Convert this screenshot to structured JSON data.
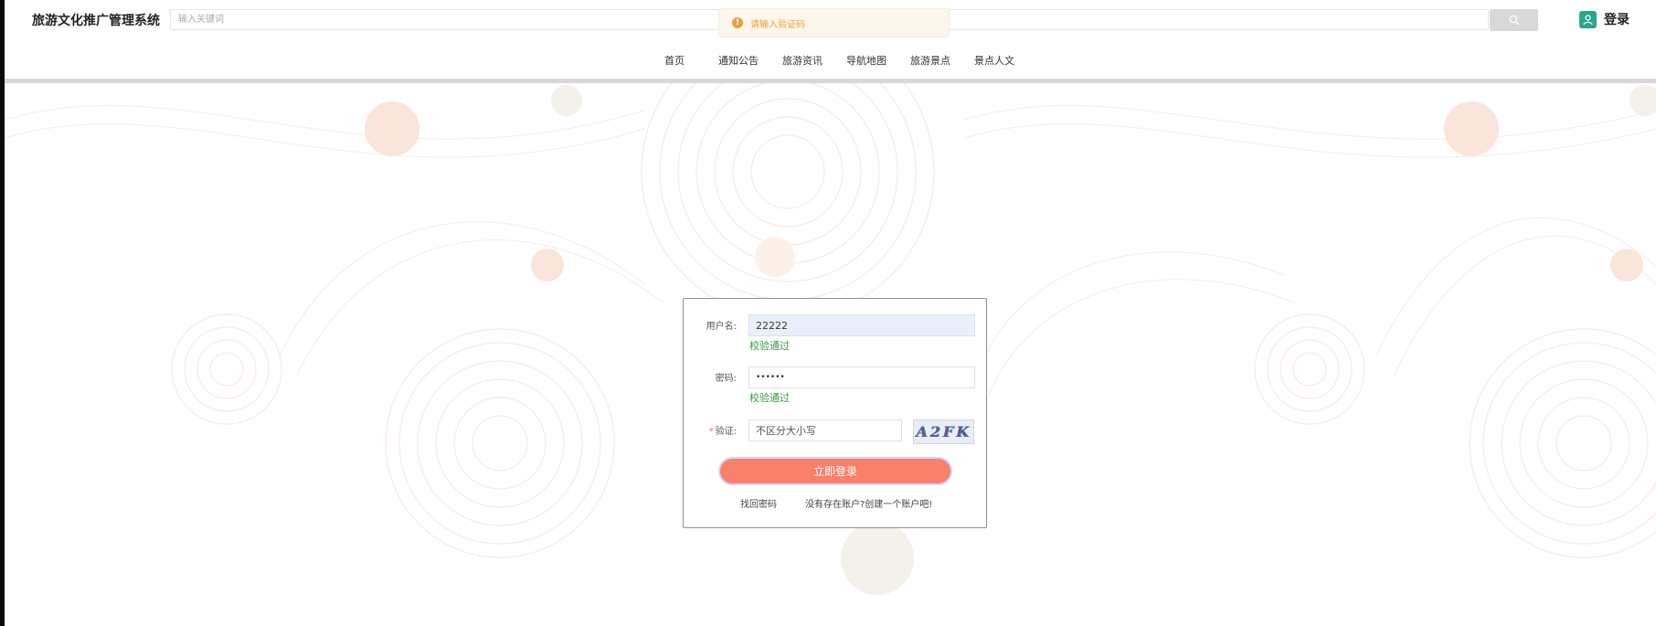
{
  "header": {
    "site_title": "旅游文化推广管理系统",
    "search_placeholder": "输入关键词",
    "login_label": "登录"
  },
  "toast": {
    "message": "请输入验证码",
    "icon": "warning-icon"
  },
  "nav": {
    "items": [
      {
        "label": "首页",
        "color": "#19a18f"
      },
      {
        "label": "通知公告",
        "color": "#f6806b"
      },
      {
        "label": "旅游资讯",
        "color": "#fbc96a"
      },
      {
        "label": "导航地图",
        "color": "#2f8fd6"
      },
      {
        "label": "旅游景点",
        "color": "#19a18f"
      },
      {
        "label": "景点人文",
        "color": "#f6806b"
      }
    ]
  },
  "login_form": {
    "username_label": "用户名:",
    "username_value": "22222",
    "username_status": "校验通过",
    "password_label": "密码:",
    "password_value": "••••••",
    "password_status": "校验通过",
    "captcha_label": "验证:",
    "captcha_placeholder": "不区分大小写",
    "captcha_image_text": "A2FK",
    "submit_label": "立即登录",
    "forgot_link": "找回密码",
    "register_link": "没有存在账户?创建一个账户吧!"
  },
  "colors": {
    "accent": "#fa8069",
    "teal": "#2aa58e",
    "success": "#3a9a3a",
    "warning": "#e6a23c"
  }
}
